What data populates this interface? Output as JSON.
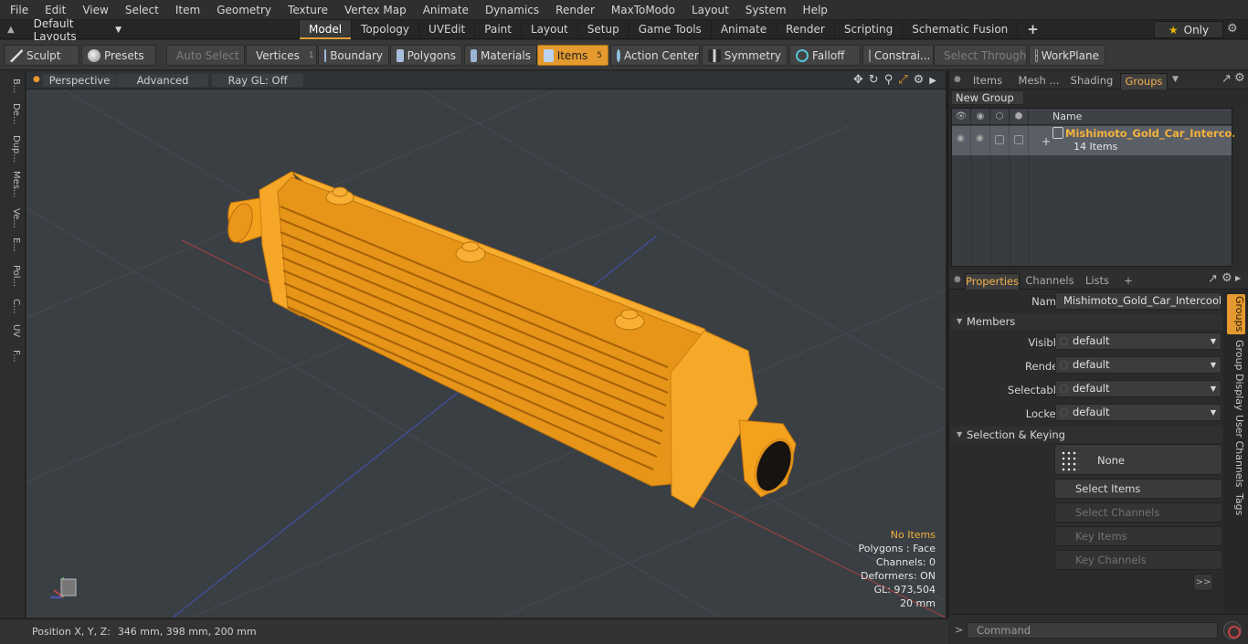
{
  "menu": [
    "File",
    "Edit",
    "View",
    "Select",
    "Item",
    "Geometry",
    "Texture",
    "Vertex Map",
    "Animate",
    "Dynamics",
    "Render",
    "MaxToModo",
    "Layout",
    "System",
    "Help"
  ],
  "layouts": {
    "label": "Default Layouts"
  },
  "layout_tabs": [
    {
      "label": "Model",
      "active": true
    },
    {
      "label": "Topology"
    },
    {
      "label": "UVEdit"
    },
    {
      "label": "Paint"
    },
    {
      "label": "Layout"
    },
    {
      "label": "Setup"
    },
    {
      "label": "Game Tools"
    },
    {
      "label": "Animate"
    },
    {
      "label": "Render"
    },
    {
      "label": "Scripting"
    },
    {
      "label": "Schematic Fusion"
    },
    {
      "label": "+"
    }
  ],
  "only_label": "Only",
  "toolbar": {
    "sculpt": "Sculpt",
    "presets": "Presets",
    "auto_select": "Auto Select",
    "vertices": "Vertices",
    "vertices_count": "1",
    "boundary": "Boundary",
    "polygons": "Polygons",
    "materials": "Materials",
    "items": "Items",
    "items_count": "5",
    "action_center": "Action Center",
    "symmetry": "Symmetry",
    "falloff": "Falloff",
    "constraints": "Constrai...",
    "select_through": "Select Through",
    "workplane": "WorkPlane"
  },
  "left_tabs": [
    "B...",
    "De...",
    "Dup...",
    "Mes...",
    "Ve...",
    "E...",
    "Pol...",
    "C...",
    "UV",
    "F..."
  ],
  "viewport": {
    "view": "Perspective",
    "shading": "Advanced",
    "raygl": "Ray GL: Off",
    "hud": {
      "no_items": "No Items",
      "polygons": "Polygons : Face",
      "channels": "Channels: 0",
      "deformers": "Deformers: ON",
      "gl": "GL: 973,504",
      "scale": "20 mm"
    }
  },
  "status": {
    "label": "Position X, Y, Z:",
    "value": "346 mm, 398 mm, 200 mm"
  },
  "groups_panel": {
    "tabs": [
      {
        "label": "Items"
      },
      {
        "label": "Mesh ..."
      },
      {
        "label": "Shading"
      },
      {
        "label": "Groups",
        "active": true
      }
    ],
    "new_group": "New Group",
    "col_name": "Name",
    "group_name": "Mishimoto_Gold_Car_Interco...",
    "group_count": "14 Items"
  },
  "properties_panel": {
    "tabs": [
      {
        "label": "Properties",
        "active": true
      },
      {
        "label": "Channels"
      },
      {
        "label": "Lists"
      },
      {
        "label": "+"
      }
    ],
    "name_label": "Name",
    "name_value": "Mishimoto_Gold_Car_Intercooler_Tw",
    "members_section": "Members",
    "visible_label": "Visible",
    "visible_value": "default",
    "render_label": "Render",
    "render_value": "default",
    "selectable_label": "Selectable",
    "selectable_value": "default",
    "locked_label": "Locked",
    "locked_value": "default",
    "selection_section": "Selection & Keying",
    "none_label": "None",
    "select_items": "Select Items",
    "select_channels": "Select Channels",
    "key_items": "Key Items",
    "key_channels": "Key Channels",
    "more": ">>"
  },
  "right_vtabs": [
    {
      "label": "Groups",
      "active": true
    },
    {
      "label": "Group Display"
    },
    {
      "label": "User Channels"
    },
    {
      "label": "Tags"
    }
  ],
  "command": {
    "placeholder": "Command"
  },
  "colors": {
    "accent": "#e49a2f",
    "model": "#f5a623",
    "viewport_bg": "#3a3f44",
    "warning_text": "#f2b13b"
  }
}
